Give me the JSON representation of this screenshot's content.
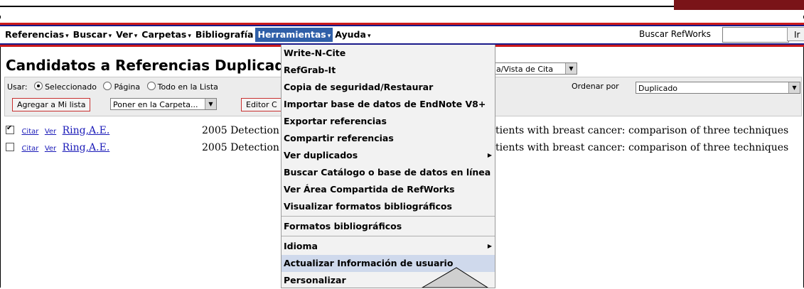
{
  "nav": {
    "items": [
      {
        "label": "Referencias",
        "arrow": "▾"
      },
      {
        "label": "Buscar",
        "arrow": "▾"
      },
      {
        "label": "Ver",
        "arrow": "▾"
      },
      {
        "label": "Carpetas",
        "arrow": "▾"
      },
      {
        "label": "Bibliografía",
        "arrow": ""
      },
      {
        "label": "Herramientas",
        "arrow": "▾"
      },
      {
        "label": "Ayuda",
        "arrow": "▾"
      }
    ],
    "search_label": "Buscar RefWorks",
    "search_value": "",
    "search_button": "Ir"
  },
  "page": {
    "title": "Candidatos a Referencias Duplicad"
  },
  "toolbar": {
    "usar_label": "Usar:",
    "radio_selected": "Seleccionado",
    "radio_page": "Página",
    "radio_all": "Todo en la Lista",
    "add_list_button": "Agregar a Mi lista",
    "folder_select": "Poner en la Carpeta...",
    "editor_button": "Editor C",
    "view_select": "a/Vista de Cita",
    "ordenar_label": "Ordenar  por",
    "ordenar_value": "Duplicado"
  },
  "rows": [
    {
      "checked": true,
      "cite": "Citar",
      "view": "Ver",
      "author": "Ring,A.E.",
      "year_title": "2005 Detection",
      "rest": "tients with breast cancer: comparison of three techniques"
    },
    {
      "checked": false,
      "cite": "Citar",
      "view": "Ver",
      "author": "Ring,A.E.",
      "year_title": "2005 Detection",
      "rest": "tients with breast cancer: comparison of three techniques"
    }
  ],
  "dropdown": {
    "items": [
      {
        "label": "Write-N-Cite",
        "submenu": false
      },
      {
        "label": "RefGrab-It",
        "submenu": false
      },
      {
        "label": "Copia de seguridad/Restaurar",
        "submenu": false
      },
      {
        "label": "Importar base de datos de EndNote V8+",
        "submenu": false
      },
      {
        "label": "Exportar referencias",
        "submenu": false
      },
      {
        "label": "Compartir referencias",
        "submenu": false
      },
      {
        "label": "Ver duplicados",
        "submenu": true
      },
      {
        "label": "Buscar Catálogo o base de datos en línea",
        "submenu": false
      },
      {
        "label": "Ver Área Compartida de RefWorks",
        "submenu": false
      },
      {
        "label": "Visualizar formatos bibliográficos",
        "submenu": false
      },
      {
        "label": "Formatos bibliográficos",
        "submenu": false
      },
      {
        "label": "Idioma",
        "submenu": true
      },
      {
        "label": "Actualizar Información de usuario",
        "submenu": false,
        "highlighted": true
      },
      {
        "label": "Personalizar",
        "submenu": false
      }
    ]
  },
  "colors": {
    "menu_active_bg": "#2f5fa8",
    "highlight_bg": "#cfd9ec",
    "brand_maroon": "#7a1418",
    "link_blue": "#1a1ab8",
    "rule_red": "#cc1a1a",
    "rule_blue": "#1a1a8a"
  }
}
